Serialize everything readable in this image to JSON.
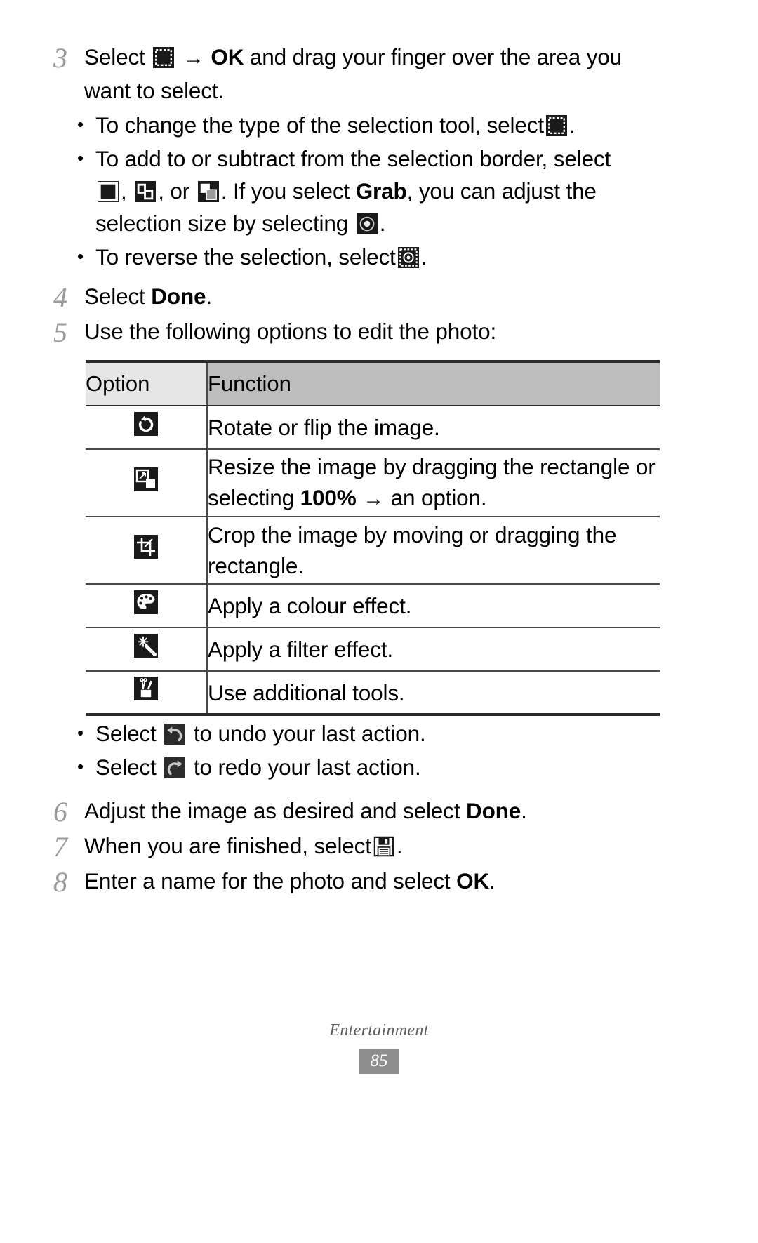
{
  "document": {
    "type": "user-manual-page",
    "footer_section": "Entertainment",
    "page_number": "85"
  },
  "steps": [
    {
      "number": "3",
      "text_before_icon": "Select",
      "icon": "selection-tool-icon",
      "arrow": "→",
      "bold_word": "OK",
      "text_after": "and drag your finger over the area you want to select."
    },
    {
      "number": "4",
      "text_before": "Select",
      "bold_word": "Done",
      "text_after": "."
    },
    {
      "number": "5",
      "text": "Use the following options to edit the photo:"
    },
    {
      "number": "6",
      "text_before": "Adjust the image as desired and select",
      "bold_word": "Done",
      "text_after": "."
    },
    {
      "number": "7",
      "text_before": "When you are finished, select",
      "icon": "save-floppy-icon",
      "text_after": "."
    },
    {
      "number": "8",
      "text_before": "Enter a name for the photo and select",
      "bold_word": "OK",
      "text_after": "."
    }
  ],
  "step3_bullets": [
    {
      "text_before": "To change the type of the selection tool, select",
      "icon": "selection-tool-icon",
      "text_after": "."
    },
    {
      "text_before": "To add to or subtract from the selection border, select",
      "icons": [
        "selection-solid-icon",
        "selection-add-icon",
        "selection-subtract-icon"
      ],
      "separator1": ",",
      "separator2": ", or",
      "mid_text": ". If you select",
      "bold_word": "Grab",
      "text_after": ", you can adjust the selection size by selecting",
      "icon_end": "grab-size-icon",
      "period": "."
    },
    {
      "text_before": "To reverse the selection, select",
      "icon": "reverse-selection-icon",
      "text_after": "."
    }
  ],
  "table": {
    "headers": [
      "Option",
      "Function"
    ],
    "rows": [
      {
        "icon": "rotate-flip-icon",
        "function_text": "Rotate or flip the image.",
        "lines": 1
      },
      {
        "icon": "resize-icon",
        "function_text_part1": "Resize the image by dragging the rectangle or selecting",
        "function_bold": "100%",
        "function_arrow": "→",
        "function_text_part2": "an option.",
        "lines": 2
      },
      {
        "icon": "crop-icon",
        "function_text": "Crop the image by moving or dragging the rectangle.",
        "lines": 2
      },
      {
        "icon": "colour-palette-icon",
        "function_text": "Apply a colour effect.",
        "lines": 1
      },
      {
        "icon": "magic-wand-filter-icon",
        "function_text": "Apply a filter effect.",
        "lines": 1
      },
      {
        "icon": "toolbox-icon",
        "function_text": "Use additional tools.",
        "lines": 1
      }
    ]
  },
  "table_bullets": [
    {
      "text_before": "Select",
      "icon": "undo-icon",
      "text_after": "to undo your last action."
    },
    {
      "text_before": "Select",
      "icon": "redo-icon",
      "text_after": "to redo your last action."
    }
  ],
  "colors": {
    "page_background": "#ffffff",
    "text": "#000000",
    "step_number": "#9a9a9a",
    "header_option_bg": "#e6e6e6",
    "header_function_bg": "#bdbdbd",
    "rule_heavy": "#2b2b2b",
    "rule_light": "#4a4a4a",
    "footer_text": "#5f5f5f",
    "page_badge_bg": "#8d8d8d"
  }
}
